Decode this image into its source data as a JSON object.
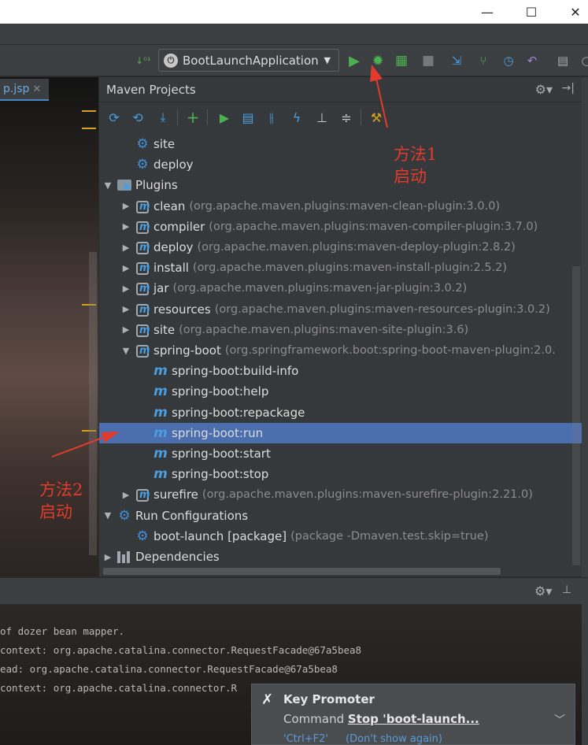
{
  "window": {
    "minimize_glyph": "—",
    "maximize_glyph": "☐",
    "close_glyph": "✕"
  },
  "run_config": {
    "label": "BootLaunchApplication"
  },
  "editor_tab": {
    "label": "p.jsp",
    "close": "✕"
  },
  "maven": {
    "title": "Maven Projects",
    "tree": [
      {
        "indent": 1,
        "arrow": "",
        "icon": "gear",
        "label": "site",
        "detail": ""
      },
      {
        "indent": 1,
        "arrow": "",
        "icon": "gear",
        "label": "deploy",
        "detail": ""
      },
      {
        "indent": 0,
        "arrow": "▼",
        "icon": "folder",
        "label": "Plugins",
        "detail": ""
      },
      {
        "indent": 1,
        "arrow": "▶",
        "icon": "plugin",
        "label": "clean",
        "detail": "(org.apache.maven.plugins:maven-clean-plugin:3.0.0)"
      },
      {
        "indent": 1,
        "arrow": "▶",
        "icon": "plugin",
        "label": "compiler",
        "detail": "(org.apache.maven.plugins:maven-compiler-plugin:3.7.0)"
      },
      {
        "indent": 1,
        "arrow": "▶",
        "icon": "plugin",
        "label": "deploy",
        "detail": "(org.apache.maven.plugins:maven-deploy-plugin:2.8.2)"
      },
      {
        "indent": 1,
        "arrow": "▶",
        "icon": "plugin",
        "label": "install",
        "detail": "(org.apache.maven.plugins:maven-install-plugin:2.5.2)"
      },
      {
        "indent": 1,
        "arrow": "▶",
        "icon": "plugin",
        "label": "jar",
        "detail": "(org.apache.maven.plugins:maven-jar-plugin:3.0.2)"
      },
      {
        "indent": 1,
        "arrow": "▶",
        "icon": "plugin",
        "label": "resources",
        "detail": "(org.apache.maven.plugins:maven-resources-plugin:3.0.2)"
      },
      {
        "indent": 1,
        "arrow": "▶",
        "icon": "plugin",
        "label": "site",
        "detail": "(org.apache.maven.plugins:maven-site-plugin:3.6)"
      },
      {
        "indent": 1,
        "arrow": "▼",
        "icon": "plugin",
        "label": "spring-boot",
        "detail": "(org.springframework.boot:spring-boot-maven-plugin:2.0."
      },
      {
        "indent": 2,
        "arrow": "",
        "icon": "goal",
        "label": "spring-boot:build-info",
        "detail": ""
      },
      {
        "indent": 2,
        "arrow": "",
        "icon": "goal",
        "label": "spring-boot:help",
        "detail": ""
      },
      {
        "indent": 2,
        "arrow": "",
        "icon": "goal",
        "label": "spring-boot:repackage",
        "detail": ""
      },
      {
        "indent": 2,
        "arrow": "",
        "icon": "goal",
        "label": "spring-boot:run",
        "detail": "",
        "selected": true
      },
      {
        "indent": 2,
        "arrow": "",
        "icon": "goal",
        "label": "spring-boot:start",
        "detail": ""
      },
      {
        "indent": 2,
        "arrow": "",
        "icon": "goal",
        "label": "spring-boot:stop",
        "detail": ""
      },
      {
        "indent": 1,
        "arrow": "▶",
        "icon": "plugin",
        "label": "surefire",
        "detail": "(org.apache.maven.plugins:maven-surefire-plugin:2.21.0)"
      },
      {
        "indent": 0,
        "arrow": "▼",
        "icon": "gear",
        "label": "Run Configurations",
        "detail": ""
      },
      {
        "indent": 1,
        "arrow": "",
        "icon": "gear",
        "label": "boot-launch [package]",
        "detail": "(package -Dmaven.test.skip=true)"
      },
      {
        "indent": 0,
        "arrow": "▶",
        "icon": "deps",
        "label": "Dependencies",
        "detail": ""
      }
    ]
  },
  "console": {
    "lines": [
      "of dozer bean mapper.",
      " context: org.apache.catalina.connector.RequestFacade@67a5bea8",
      "ead: org.apache.catalina.connector.RequestFacade@67a5bea8",
      " context: org.apache.catalina.connector.R"
    ]
  },
  "key_promoter": {
    "title": "Key Promoter",
    "message_prefix": "Command",
    "command": "Stop 'boot-launch...",
    "shortcut": "'Ctrl+F2'",
    "dont_show": "(Don't show again)"
  },
  "annotations": {
    "method1_line1": "方法1",
    "method1_line2": "启动",
    "method2_line1": "方法2",
    "method2_line2": "启动"
  },
  "colors": {
    "accent_selection": "#4b6eaf",
    "annotation_red": "#e23b2b",
    "run_green": "#4caf50",
    "gear_blue": "#3f8fd8"
  }
}
